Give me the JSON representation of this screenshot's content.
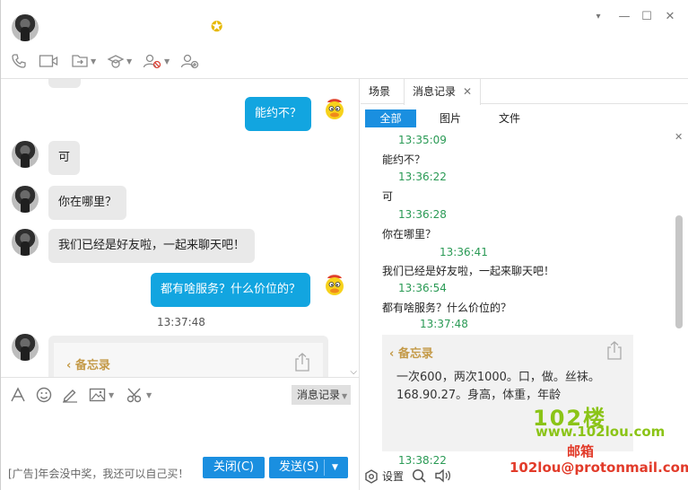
{
  "window": {
    "minimize": "▾",
    "min_btn": "—",
    "max_btn": "☐",
    "close_btn": "✕"
  },
  "chat": {
    "messages": [
      {
        "direction": "out",
        "text": "能约不？"
      },
      {
        "direction": "in",
        "text": "可"
      },
      {
        "direction": "in",
        "text": "你在哪里？"
      },
      {
        "direction": "in",
        "text": "我们已经是好友啦，一起来聊天吧！"
      },
      {
        "direction": "out",
        "text": "都有啥服务？什么价位的？"
      }
    ],
    "timestamp": "13:37:48",
    "memo_back": "备忘录"
  },
  "input": {
    "history_btn": "消息记录",
    "ad": "[广告]年会没中奖，我还可以自己买！",
    "close_btn": "关闭(C)",
    "send_btn": "发送(S)"
  },
  "right": {
    "tabs": [
      {
        "label": "场景"
      },
      {
        "label": "消息记录"
      }
    ],
    "filters": [
      {
        "label": "全部"
      },
      {
        "label": "图片"
      },
      {
        "label": "文件"
      }
    ],
    "log": [
      {
        "kind": "time",
        "text": "13:35:09"
      },
      {
        "kind": "text",
        "text": "能约不？"
      },
      {
        "kind": "time",
        "text": "13:36:22"
      },
      {
        "kind": "text",
        "text": "可"
      },
      {
        "kind": "time",
        "text": "13:36:28"
      },
      {
        "kind": "text",
        "text": "你在哪里？"
      },
      {
        "kind": "time",
        "text": "13:36:41"
      },
      {
        "kind": "text",
        "text": "我们已经是好友啦，一起来聊天吧！"
      },
      {
        "kind": "time",
        "text": "13:36:54"
      },
      {
        "kind": "text",
        "text": "都有啥服务？什么价位的？"
      },
      {
        "kind": "time",
        "text": "13:37:48"
      }
    ],
    "memo_back": "备忘录",
    "memo_lines": [
      "一次600，两次1000。口，做。丝袜。",
      "168.90.27。身高，体重，年龄"
    ],
    "last_time": "13:38:22",
    "settings_label": "设置"
  },
  "watermark": {
    "brand": "102楼",
    "url": "www.102lou.com",
    "mail_label": "邮箱",
    "email": "102lou@protonmail.com"
  },
  "colors": {
    "accent": "#1a8fe0",
    "out_bubble": "#12a5e0",
    "time_green": "#2a9a55",
    "watermark_green": "#8bc417",
    "watermark_red": "#e23b2a"
  }
}
